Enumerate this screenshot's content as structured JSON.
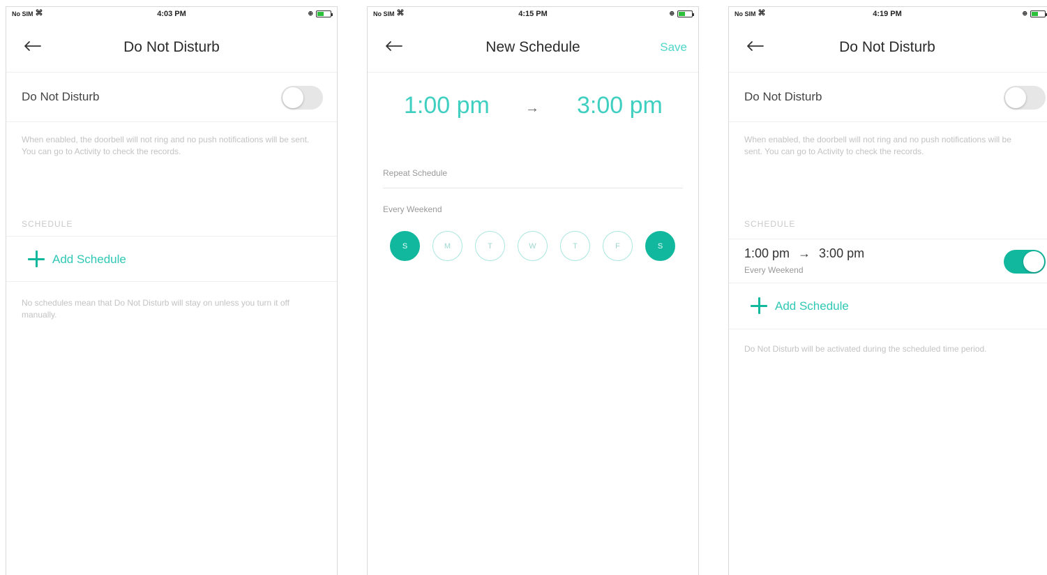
{
  "screens": [
    {
      "status": {
        "carrier": "No SIM",
        "time": "4:03 PM"
      },
      "nav": {
        "title": "Do Not Disturb"
      },
      "dnd_label": "Do Not Disturb",
      "dnd_enabled": false,
      "description": "When enabled, the doorbell will not ring and no push notifications will be sent. You can go to Activity to check the records.",
      "schedule_header": "SCHEDULE",
      "add_schedule_label": "Add Schedule",
      "footer_note": "No schedules mean that Do Not Disturb will stay on unless you turn it off manually."
    },
    {
      "status": {
        "carrier": "No SIM",
        "time": "4:15 PM"
      },
      "nav": {
        "title": "New Schedule",
        "save_label": "Save"
      },
      "start_time": "1:00 pm",
      "arrow": "→",
      "end_time": "3:00 pm",
      "repeat_label": "Repeat Schedule",
      "repeat_value": "Every Weekend",
      "days": [
        {
          "label": "S",
          "active": true
        },
        {
          "label": "M",
          "active": false
        },
        {
          "label": "T",
          "active": false
        },
        {
          "label": "W",
          "active": false
        },
        {
          "label": "T",
          "active": false
        },
        {
          "label": "F",
          "active": false
        },
        {
          "label": "S",
          "active": true
        }
      ]
    },
    {
      "status": {
        "carrier": "No SIM",
        "time": "4:19 PM"
      },
      "nav": {
        "title": "Do Not Disturb"
      },
      "dnd_label": "Do Not Disturb",
      "dnd_enabled": false,
      "description": "When enabled, the doorbell will not ring and no push notifications will be sent. You can go to Activity to check the records.",
      "schedule_header": "SCHEDULE",
      "schedule": {
        "start": "1:00 pm",
        "arrow": "→",
        "end": "3:00 pm",
        "repeat": "Every Weekend",
        "enabled": true
      },
      "add_schedule_label": "Add Schedule",
      "footer_note": "Do Not Disturb will be activated during the scheduled time period."
    }
  ],
  "colors": {
    "accent": "#12b89e",
    "accent_light": "#3fcfc0",
    "toggle_off": "#e6e6e6"
  },
  "icons": {
    "back": "back-arrow-icon",
    "add": "plus-icon",
    "wifi": "wifi-icon",
    "battery": "battery-icon"
  },
  "battery_level": 0.5
}
